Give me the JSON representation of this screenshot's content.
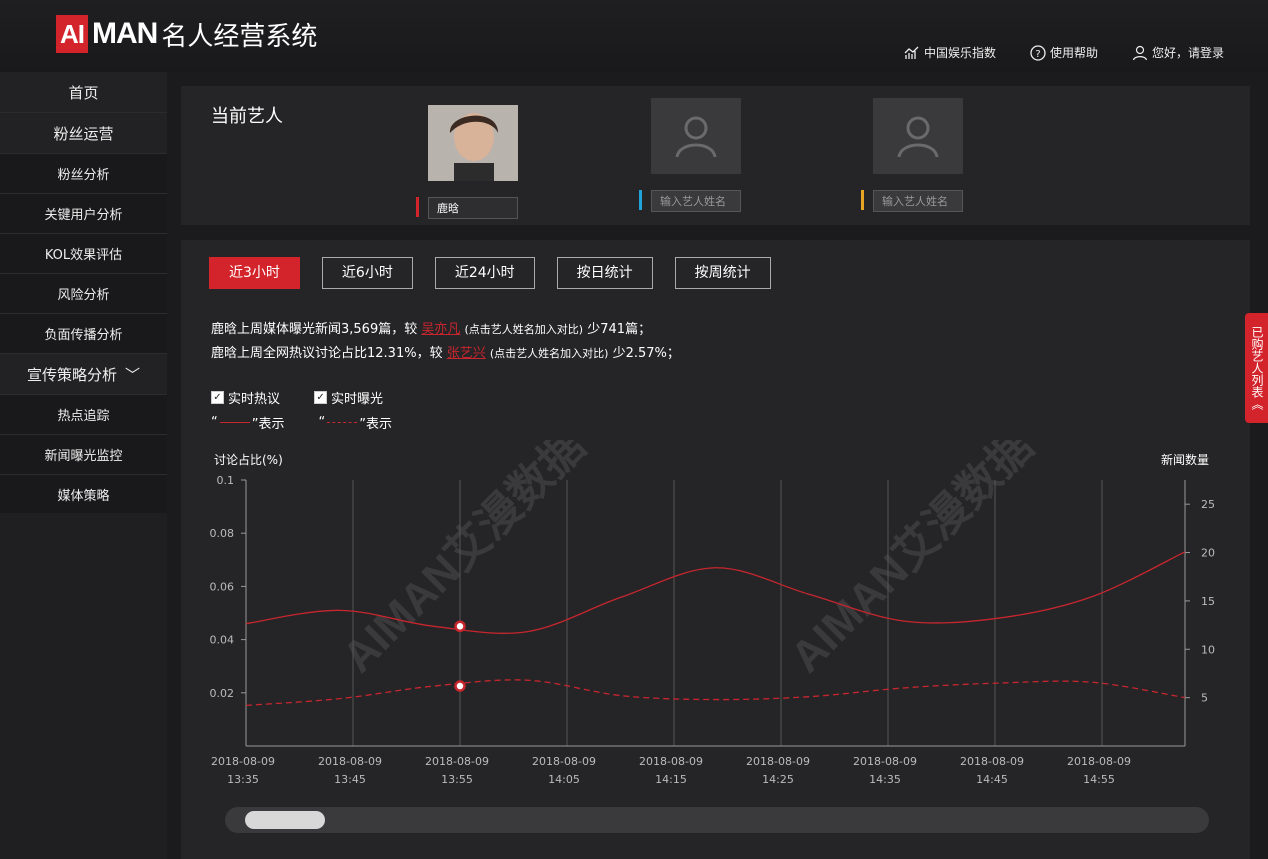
{
  "header": {
    "logo_ai": "AI",
    "logo_man": "MAN",
    "logo_sub": "名人经营系统",
    "links": [
      {
        "icon": "chart-icon",
        "label": "中国娱乐指数"
      },
      {
        "icon": "help-icon",
        "label": "使用帮助"
      },
      {
        "icon": "user-icon",
        "label": "您好，请登录"
      }
    ]
  },
  "sidebar": {
    "items": [
      {
        "label": "首页"
      },
      {
        "label": "粉丝运营"
      },
      {
        "label": "粉丝分析"
      },
      {
        "label": "关键用户分析"
      },
      {
        "label": "KOL效果评估"
      },
      {
        "label": "风险分析"
      },
      {
        "label": "负面传播分析"
      },
      {
        "label": "宣传策略分析",
        "arrow": "﹀"
      },
      {
        "label": "热点追踪"
      },
      {
        "label": "新闻曝光监控"
      },
      {
        "label": "媒体策略"
      }
    ]
  },
  "artists": {
    "title": "当前艺人",
    "slots": [
      {
        "name": "鹿晗",
        "color": "#d3232b"
      },
      {
        "placeholder": "输入艺人姓名",
        "color": "#1fa3d8"
      },
      {
        "placeholder": "输入艺人姓名",
        "color": "#e8a524"
      }
    ]
  },
  "tabs": [
    {
      "label": "近3小时",
      "active": true
    },
    {
      "label": "近6小时"
    },
    {
      "label": "近24小时"
    },
    {
      "label": "按日统计"
    },
    {
      "label": "按周统计"
    }
  ],
  "info": {
    "line1_a": "鹿晗上周媒体曝光新闻3,569篇，较",
    "line1_link": "吴亦凡",
    "line1_hint": "(点击艺人姓名加入对比)",
    "line1_b": "少741篇；",
    "line2_a": "鹿晗上周全网热议讨论占比12.31%，较",
    "line2_link": "张艺兴",
    "line2_hint": "(点击艺人姓名加入对比)",
    "line2_b": "少2.57%；"
  },
  "legend": {
    "check1": "实时热议",
    "check2": "实时曝光",
    "leg1_open": "“",
    "leg1_close": "”表示",
    "leg2_open": "“",
    "leg2_close": "”表示"
  },
  "side_tab": "已购艺人列表《",
  "chart_data": {
    "type": "line",
    "ylabel_left": "讨论占比(%)",
    "ylabel_right": "新闻数量",
    "y_left_ticks": [
      "0.1",
      "0.08",
      "0.06",
      "0.04",
      "0.02"
    ],
    "y_right_ticks": [
      "25",
      "20",
      "15",
      "10",
      "5"
    ],
    "ylim_left": [
      0,
      0.1
    ],
    "ylim_right": [
      0,
      27.5
    ],
    "x_labels": [
      [
        "2018-08-09",
        "13:35"
      ],
      [
        "2018-08-09",
        "13:45"
      ],
      [
        "2018-08-09",
        "13:55"
      ],
      [
        "2018-08-09",
        "14:05"
      ],
      [
        "2018-08-09",
        "14:15"
      ],
      [
        "2018-08-09",
        "14:25"
      ],
      [
        "2018-08-09",
        "14:35"
      ],
      [
        "2018-08-09",
        "14:45"
      ],
      [
        "2018-08-09",
        "14:55"
      ]
    ],
    "series": [
      {
        "axis": "left",
        "style": "solid",
        "values": [
          0.046,
          0.051,
          0.045,
          0.043,
          0.056,
          0.067,
          0.057,
          0.047,
          0.048,
          0.056,
          0.073
        ]
      },
      {
        "axis": "right",
        "style": "dashed",
        "values": [
          4.2,
          4.9,
          6.2,
          6.8,
          5.2,
          4.8,
          5.1,
          6.0,
          6.5,
          6.6,
          5.0
        ]
      }
    ],
    "watermark": "AIMAN艾漫数据",
    "grid": "vertical",
    "colors": {
      "line": "#c8262e"
    }
  }
}
